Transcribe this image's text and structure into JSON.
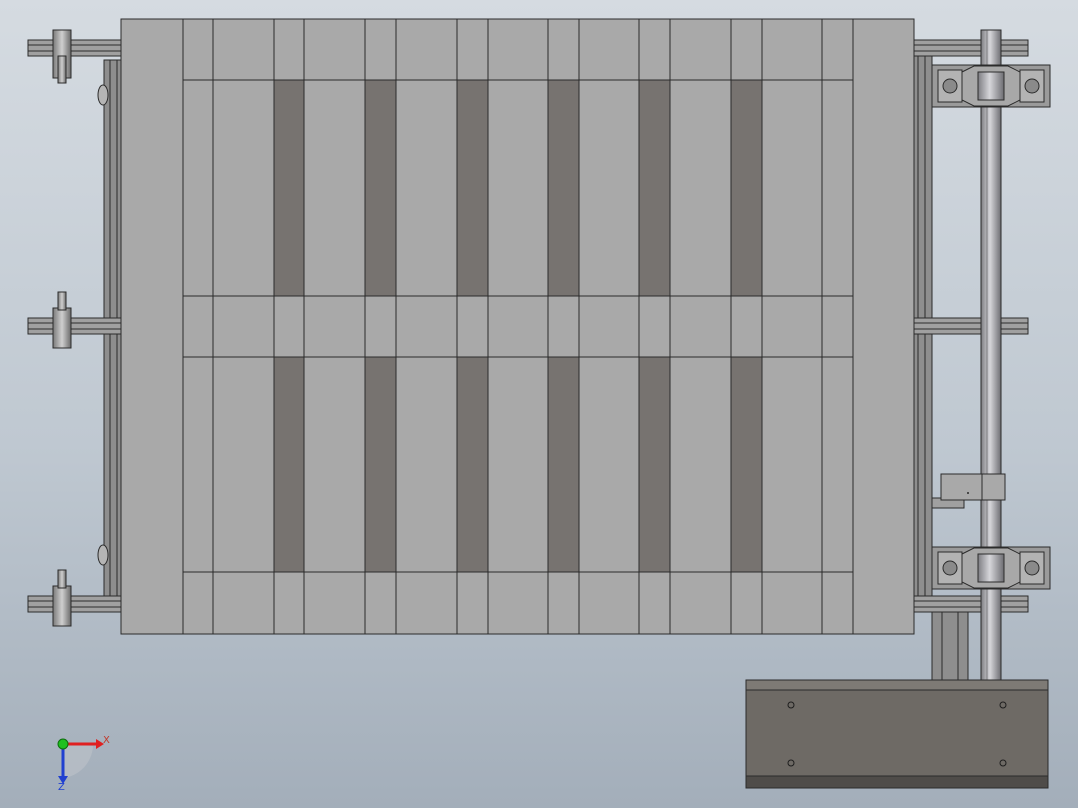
{
  "viewport": {
    "background_top": "#d5dbe1",
    "background_bottom": "#a3aeba"
  },
  "model": {
    "slat_color": "#a9a9a9",
    "slat_shade": "#9c9c9c",
    "gap_dark": "#777370",
    "edge_color": "#2b2b2b",
    "frame_color": "#8c8c8c",
    "shaft_color": "#9e9ea3",
    "motor_color": "#6f6b66"
  },
  "triad": {
    "x_label": "X",
    "z_label": "Z",
    "x_color": "#e02020",
    "y_color": "#20c020",
    "z_color": "#2040d0"
  }
}
